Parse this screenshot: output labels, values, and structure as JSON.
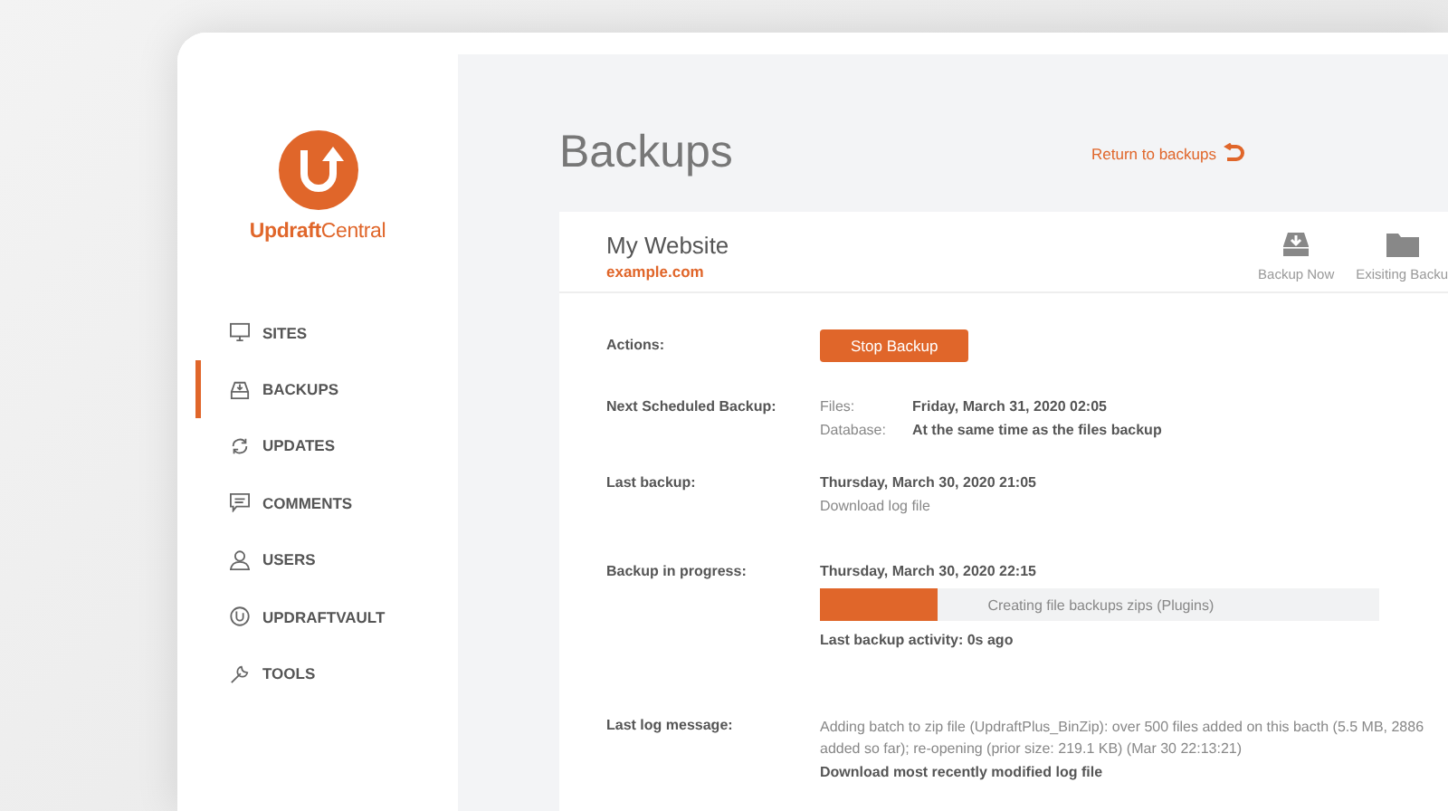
{
  "sidebar": {
    "logo_text": "**Updraft**Central",
    "items": [
      {
        "label": "SITES",
        "selected": false
      },
      {
        "label": "BACKUPS",
        "selected": true
      },
      {
        "label": "UPDATES",
        "selected": false
      },
      {
        "label": "COMMENTS",
        "selected": false
      },
      {
        "label": "USERS",
        "selected": false
      },
      {
        "label": "UPDRAFTVAULT",
        "selected": false
      },
      {
        "label": "TOOLS",
        "selected": false
      }
    ]
  },
  "page": {
    "title": "Backups",
    "return_link": "Return to backups"
  },
  "site": {
    "name": "My Website",
    "url": "example.com",
    "actions": [
      {
        "label": "Backup Now"
      },
      {
        "label": "Exisiting Backu"
      }
    ]
  },
  "details": {
    "actions_label": "Actions:",
    "stop_button": "Stop Backup",
    "next_label": "Next Scheduled Backup:",
    "files_label": "Files:",
    "files_value": "Friday, March 31, 2020 02:05",
    "database_label": "Database:",
    "database_value": "At the same time as the files backup",
    "last_label": "Last backup:",
    "last_value": "Thursday, March 30, 2020 21:05",
    "last_link": "Download log file",
    "progress_label": "Backup in progress:",
    "progress_date": "Thursday, March 30, 2020 22:15",
    "progress": {
      "level": 0.21,
      "text": "Creating file backups zips (Plugins)"
    },
    "activity": "Last backup activity: 0s ago",
    "log_label": "Last log message:",
    "log_text": "Adding batch to zip file (UpdraftPlus_BinZip): over 500 files added on this bacth (5.5 MB, 2886 added so far); re-opening (prior size: 219.1 KB) (Mar 30 22:13:21)",
    "log_link": "Download most recently modified log file"
  }
}
